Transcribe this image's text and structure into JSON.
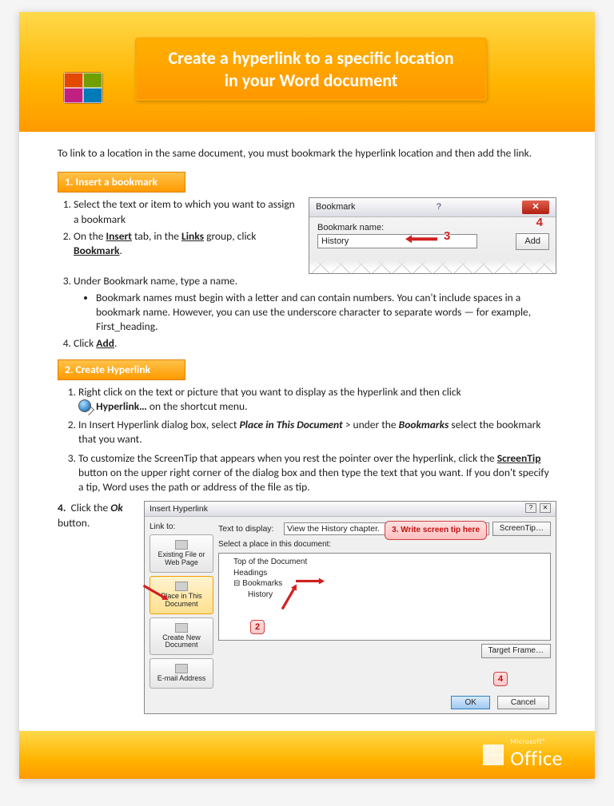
{
  "header": {
    "title_line1": "Create a hyperlink to a specific location",
    "title_line2": "in your Word document"
  },
  "intro": "To link to a location in the same document, you must bookmark the hyperlink location and then add the link.",
  "section1": {
    "heading": "1.   Insert a bookmark",
    "steps": {
      "s1": "Select the text or item to which you want to assign a bookmark",
      "s2_pre": "On the ",
      "s2_tab": "Insert",
      "s2_mid": " tab, in the ",
      "s2_group": "Links",
      "s2_post": " group, click ",
      "s2_cmd": "Bookmark",
      "s3": "Under Bookmark name, type a name.",
      "s3_bullet": "Bookmark names must begin with a letter and can contain numbers. You can't include spaces in a bookmark name. However, you can use the underscore character to separate words — for example, First_heading.",
      "s4_pre": "Click ",
      "s4_cmd": "Add"
    },
    "dialog": {
      "title": "Bookmark",
      "label": "Bookmark name:",
      "value": "History",
      "add": "Add",
      "callout3": "3",
      "callout4": "4"
    }
  },
  "section2": {
    "heading": "2. Create Hyperlink",
    "steps": {
      "s1_pre": "Right click on the text or picture that you want to display as the hyperlink and then click",
      "s1_cmd": "Hyperlink…",
      "s1_post": " on the shortcut menu.",
      "s2_pre": "In Insert Hyperlink dialog box, select ",
      "s2_place": "Place in This Document",
      "s2_mid": " > under the ",
      "s2_bm": "Bookmarks",
      "s2_post": " select the bookmark that you want.",
      "s3_pre": "To customize the ScreenTip that appears when you rest the pointer over the hyperlink, click the ",
      "s3_cmd": "ScreenTip",
      "s3_post": " button on the upper right corner of the dialog box and then type the text that you want. If you don't specify a tip, Word uses the path or address of the file as tip.",
      "s4_pre": "Click the ",
      "s4_cmd": "Ok",
      "s4_post": " button."
    },
    "dialog": {
      "title": "Insert Hyperlink",
      "linkto": "Link to:",
      "text_to_display_label": "Text to display:",
      "text_to_display": "View the History chapter.",
      "screentip_btn": "ScreenTip…",
      "select_label": "Select a place in this document:",
      "tree": {
        "top": "Top of the Document",
        "headings": "Headings",
        "bookmarks": "Bookmarks",
        "history": "History"
      },
      "side": {
        "existing": "Existing File or Web Page",
        "place": "Place in This Document",
        "newdoc": "Create New Document",
        "email": "E-mail Address"
      },
      "target_frame": "Target Frame…",
      "ok": "OK",
      "cancel": "Cancel",
      "tip_callout": "3. Write screen tip here",
      "num2": "2",
      "num4": "4"
    }
  },
  "footer": {
    "brand_small": "Microsoft®",
    "brand": "Office"
  }
}
